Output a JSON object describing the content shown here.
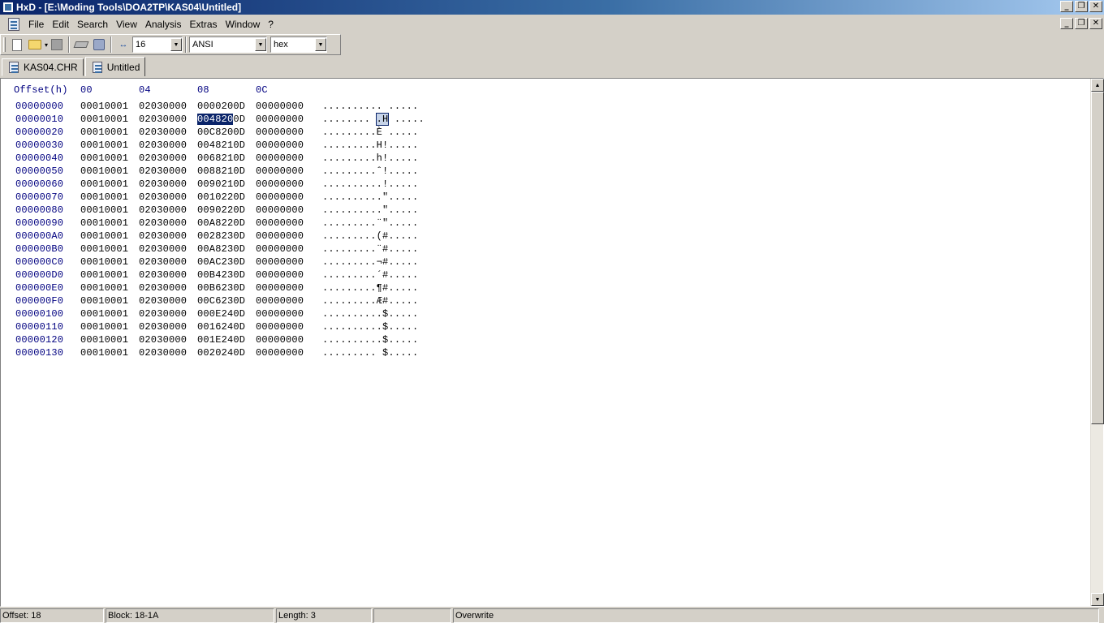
{
  "window": {
    "title": "HxD - [E:\\Moding Tools\\DOA2TP\\KAS04\\Untitled]",
    "minimize_glyph": "_",
    "restore_glyph": "❐",
    "close_glyph": "✕"
  },
  "menu": [
    "File",
    "Edit",
    "Search",
    "View",
    "Analysis",
    "Extras",
    "Window",
    "?"
  ],
  "toolbar": {
    "bytes_per_row": "16",
    "charset": "ANSI",
    "offset_base": "hex",
    "width_icon_glyph": "↔",
    "dropdown_glyph": "▾",
    "combo_arrow_glyph": "▼"
  },
  "tabs": [
    {
      "label": "KAS04.CHR",
      "active": false
    },
    {
      "label": "Untitled",
      "active": true
    }
  ],
  "hex_view": {
    "header": {
      "offset": "Offset(h)",
      "cols": [
        "00",
        "04",
        "08",
        "0C"
      ]
    },
    "rows": [
      {
        "offset": "00000000",
        "g": [
          "00010001",
          "02030000",
          "0000200D",
          "00000000"
        ],
        "ascii": ".......... ....."
      },
      {
        "offset": "00000010",
        "g": [
          "00010001",
          "02030000",
          "0048200D",
          "00000000"
        ],
        "ascii": "........ .H ....."
      },
      {
        "offset": "00000020",
        "g": [
          "00010001",
          "02030000",
          "00C8200D",
          "00000000"
        ],
        "ascii": ".........È ....."
      },
      {
        "offset": "00000030",
        "g": [
          "00010001",
          "02030000",
          "0048210D",
          "00000000"
        ],
        "ascii": ".........H!....."
      },
      {
        "offset": "00000040",
        "g": [
          "00010001",
          "02030000",
          "0068210D",
          "00000000"
        ],
        "ascii": ".........h!....."
      },
      {
        "offset": "00000050",
        "g": [
          "00010001",
          "02030000",
          "0088210D",
          "00000000"
        ],
        "ascii": ".........ˆ!....."
      },
      {
        "offset": "00000060",
        "g": [
          "00010001",
          "02030000",
          "0090210D",
          "00000000"
        ],
        "ascii": "..........!....."
      },
      {
        "offset": "00000070",
        "g": [
          "00010001",
          "02030000",
          "0010220D",
          "00000000"
        ],
        "ascii": "..........\"....."
      },
      {
        "offset": "00000080",
        "g": [
          "00010001",
          "02030000",
          "0090220D",
          "00000000"
        ],
        "ascii": "..........\"....."
      },
      {
        "offset": "00000090",
        "g": [
          "00010001",
          "02030000",
          "00A8220D",
          "00000000"
        ],
        "ascii": ".........¨\"....."
      },
      {
        "offset": "000000A0",
        "g": [
          "00010001",
          "02030000",
          "0028230D",
          "00000000"
        ],
        "ascii": ".........(#....."
      },
      {
        "offset": "000000B0",
        "g": [
          "00010001",
          "02030000",
          "00A8230D",
          "00000000"
        ],
        "ascii": ".........¨#....."
      },
      {
        "offset": "000000C0",
        "g": [
          "00010001",
          "02030000",
          "00AC230D",
          "00000000"
        ],
        "ascii": ".........¬#....."
      },
      {
        "offset": "000000D0",
        "g": [
          "00010001",
          "02030000",
          "00B4230D",
          "00000000"
        ],
        "ascii": ".........´#....."
      },
      {
        "offset": "000000E0",
        "g": [
          "00010001",
          "02030000",
          "00B6230D",
          "00000000"
        ],
        "ascii": ".........¶#....."
      },
      {
        "offset": "000000F0",
        "g": [
          "00010001",
          "02030000",
          "00C6230D",
          "00000000"
        ],
        "ascii": ".........Æ#....."
      },
      {
        "offset": "00000100",
        "g": [
          "00010001",
          "02030000",
          "000E240D",
          "00000000"
        ],
        "ascii": "..........$....."
      },
      {
        "offset": "00000110",
        "g": [
          "00010001",
          "02030000",
          "0016240D",
          "00000000"
        ],
        "ascii": "..........$....."
      },
      {
        "offset": "00000120",
        "g": [
          "00010001",
          "02030000",
          "001E240D",
          "00000000"
        ],
        "ascii": "..........$....."
      },
      {
        "offset": "00000130",
        "g": [
          "00010001",
          "02030000",
          "0020240D",
          "00000000"
        ],
        "ascii": "......... $....."
      }
    ],
    "selected_hex": "004820",
    "selected_ascii": ".H"
  },
  "scrollbar": {
    "up_glyph": "▲",
    "down_glyph": "▼"
  },
  "status": {
    "offset": "Offset: 18",
    "block": "Block: 18-1A",
    "length": "Length: 3",
    "empty": "",
    "mode": "Overwrite"
  },
  "colors": {
    "offset_text": "#000080",
    "selection_bg": "#0a246a",
    "titlebar_start": "#0a246a"
  }
}
